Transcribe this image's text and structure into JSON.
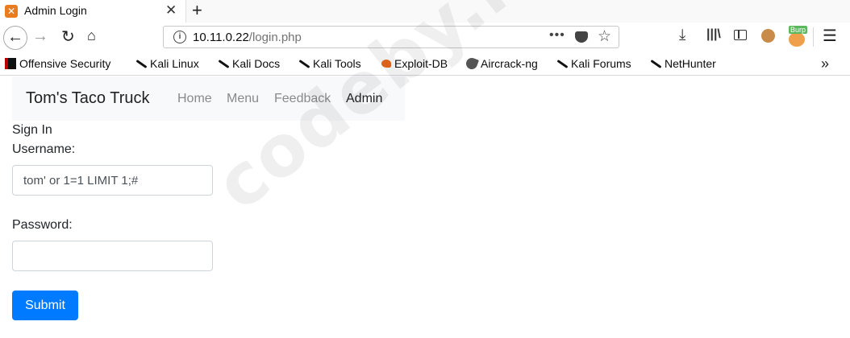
{
  "browser": {
    "tab_title": "Admin Login",
    "tab_close": "✕",
    "new_tab": "+",
    "url_host": "10.11.0.22",
    "url_path": "/login.php",
    "url_more": "•••",
    "burp_label": "Burp",
    "icons": {
      "back": "back-arrow-icon",
      "forward": "forward-arrow-icon",
      "reload": "reload-icon",
      "home": "home-icon",
      "info": "info-icon",
      "pocket": "pocket-icon",
      "bookmark": "star-icon",
      "download": "download-icon",
      "library": "library-icon",
      "sidebar": "sidebar-icon",
      "cookie": "cookie-icon",
      "burp": "burp-icon",
      "menu": "hamburger-menu-icon"
    }
  },
  "bookmarks": [
    {
      "label": "Offensive Security",
      "icon": "offensive-security-icon"
    },
    {
      "label": "Kali Linux",
      "icon": "kali-dragon-icon"
    },
    {
      "label": "Kali Docs",
      "icon": "kali-dragon-icon"
    },
    {
      "label": "Kali Tools",
      "icon": "kali-dragon-icon"
    },
    {
      "label": "Exploit-DB",
      "icon": "exploit-db-icon"
    },
    {
      "label": "Aircrack-ng",
      "icon": "aircrack-icon"
    },
    {
      "label": "Kali Forums",
      "icon": "kali-dragon-icon"
    },
    {
      "label": "NetHunter",
      "icon": "kali-dragon-icon"
    }
  ],
  "bookmarks_overflow": "»",
  "site": {
    "brand": "Tom's Taco Truck",
    "nav": [
      "Home",
      "Menu",
      "Feedback",
      "Admin"
    ],
    "active_nav": "Admin"
  },
  "form": {
    "heading": "Sign In",
    "username_label": "Username:",
    "username_value": "tom' or 1=1 LIMIT 1;#",
    "password_label": "Password:",
    "password_value": "",
    "submit_label": "Submit"
  },
  "watermark": "codeby.net",
  "colors": {
    "primary": "#007bff",
    "navbar_bg": "#f8f9fa",
    "link_muted": "#8a8a8a"
  }
}
